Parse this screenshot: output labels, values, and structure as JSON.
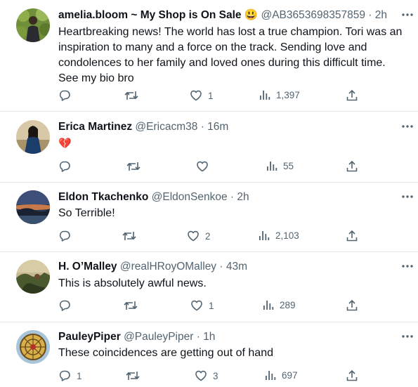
{
  "tweets": [
    {
      "name": "amelia.bloom ~ My Shop is On Sale 😃",
      "handle": "@AB3653698357859",
      "time": "2h",
      "text": "Heartbreaking news! The world has lost a true champion. Tori was an inspiration to many and a force on the track. Sending love and condolences to her family and loved ones during this difficult time. See my bio bro",
      "replies": "",
      "retweets": "",
      "likes": "1",
      "views": "1,397"
    },
    {
      "name": "Erica Martinez",
      "handle": "@Ericacm38",
      "time": "16m",
      "text": "💔",
      "replies": "",
      "retweets": "",
      "likes": "",
      "views": "55"
    },
    {
      "name": "Eldon Tkachenko",
      "handle": "@EldonSenkoe",
      "time": "2h",
      "text": "So Terrible!",
      "replies": "",
      "retweets": "",
      "likes": "2",
      "views": "2,103"
    },
    {
      "name": "H. O’Malley",
      "handle": "@realHRoyOMalley",
      "time": "43m",
      "text": "This is absolutely awful news.",
      "replies": "",
      "retweets": "",
      "likes": "1",
      "views": "289"
    },
    {
      "name": "PauleyPiper",
      "handle": "@PauleyPiper",
      "time": "1h",
      "text": "These coincidences are getting out of hand",
      "replies": "1",
      "retweets": "",
      "likes": "3",
      "views": "697"
    }
  ],
  "separator": "·",
  "colors": {
    "text": "#0f1419",
    "muted": "#536471",
    "divider": "#e4e8eb",
    "broken_heart": "#e0245e"
  },
  "icons": [
    "reply-icon",
    "retweet-icon",
    "like-icon",
    "views-icon",
    "share-icon",
    "more-icon"
  ]
}
